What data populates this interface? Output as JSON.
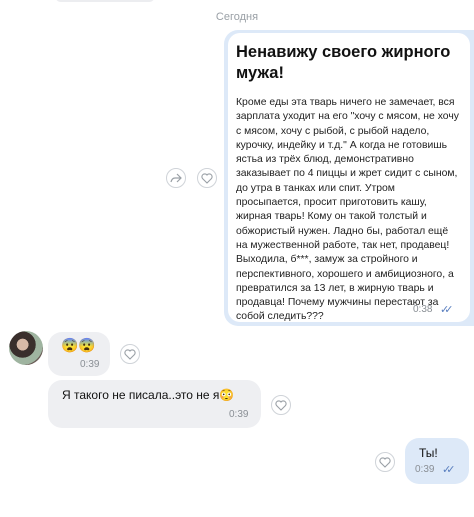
{
  "date_separator": "Сегодня",
  "repost": {
    "title": "Ненавижу своего жирного мужа!",
    "body": "Кроме еды эта тварь ничего не замечает, вся зарплата уходит на его \"хочу с мясом, не хочу с мясом, хочу с рыбой, с рыбой надело, курочку, индейку и т.д.\" А когда не готовишь ястьа из трёх блюд, демонстративно заказывает по 4 пиццы и жрет сидит с сыном, до утра в танках или спит. Утром просыпается, просит приготовить кашу, жирная тварь! Кому он такой толстый и обжористый нужен. Ладно бы, работал ещё на мужественной работе, так нет, продавец! Выходила, б***, замуж за стройного и перспективного, хорошего и амбициозного, а превратился за 13 лет, в жирную тварь и продавца! Почему мужчины перестают за собой следить???",
    "time": "0:38",
    "share_icon": "share-icon",
    "like_icon": "heart-icon"
  },
  "messages": [
    {
      "text": "😨😨",
      "time": "0:39"
    },
    {
      "text": "Я такого не писала..это не я😳",
      "time": "0:39"
    },
    {
      "text": "Ты!",
      "time": "0:39"
    }
  ],
  "colors": {
    "outgoing_bubble": "#dde9f8",
    "incoming_bubble": "#eeeff2",
    "read_check": "#5a7fbf"
  }
}
